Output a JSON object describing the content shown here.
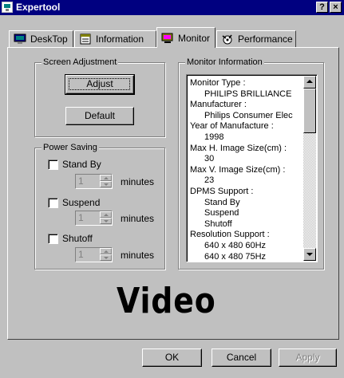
{
  "window": {
    "title": "Expertool",
    "help_label": "?",
    "close_label": "×"
  },
  "tabs": [
    {
      "label": "DeskTop",
      "icon": "desktop-icon"
    },
    {
      "label": "Information",
      "icon": "information-icon"
    },
    {
      "label": "Monitor",
      "icon": "monitor-icon"
    },
    {
      "label": "Performance",
      "icon": "performance-icon"
    }
  ],
  "screen_adjustment": {
    "title": "Screen Adjustment",
    "adjust_label": "Adjust",
    "default_label": "Default"
  },
  "power_saving": {
    "title": "Power Saving",
    "items": [
      {
        "label": "Stand By",
        "value": "1",
        "unit": "minutes",
        "checked": false
      },
      {
        "label": "Suspend",
        "value": "1",
        "unit": "minutes",
        "checked": false
      },
      {
        "label": "Shutoff",
        "value": "1",
        "unit": "minutes",
        "checked": false
      }
    ]
  },
  "monitor_info": {
    "title": "Monitor Information",
    "lines": [
      "Monitor Type :",
      "PHILIPS BRILLIANCE",
      "Manufacturer :",
      "Philips Consumer Elec",
      "Year of Manufacture :",
      "1998",
      "Max H. Image Size(cm) :",
      "30",
      "Max V. Image Size(cm) :",
      "23",
      "DPMS Support :",
      "Stand By",
      "Suspend",
      "Shutoff",
      "Resolution Support :",
      "640 x 480 60Hz",
      "640 x 480 75Hz"
    ]
  },
  "logo_text": "Video",
  "footer": {
    "ok_label": "OK",
    "cancel_label": "Cancel",
    "apply_label": "Apply"
  },
  "colors": {
    "titlebar": "#000080",
    "face": "#c0c0c0"
  }
}
